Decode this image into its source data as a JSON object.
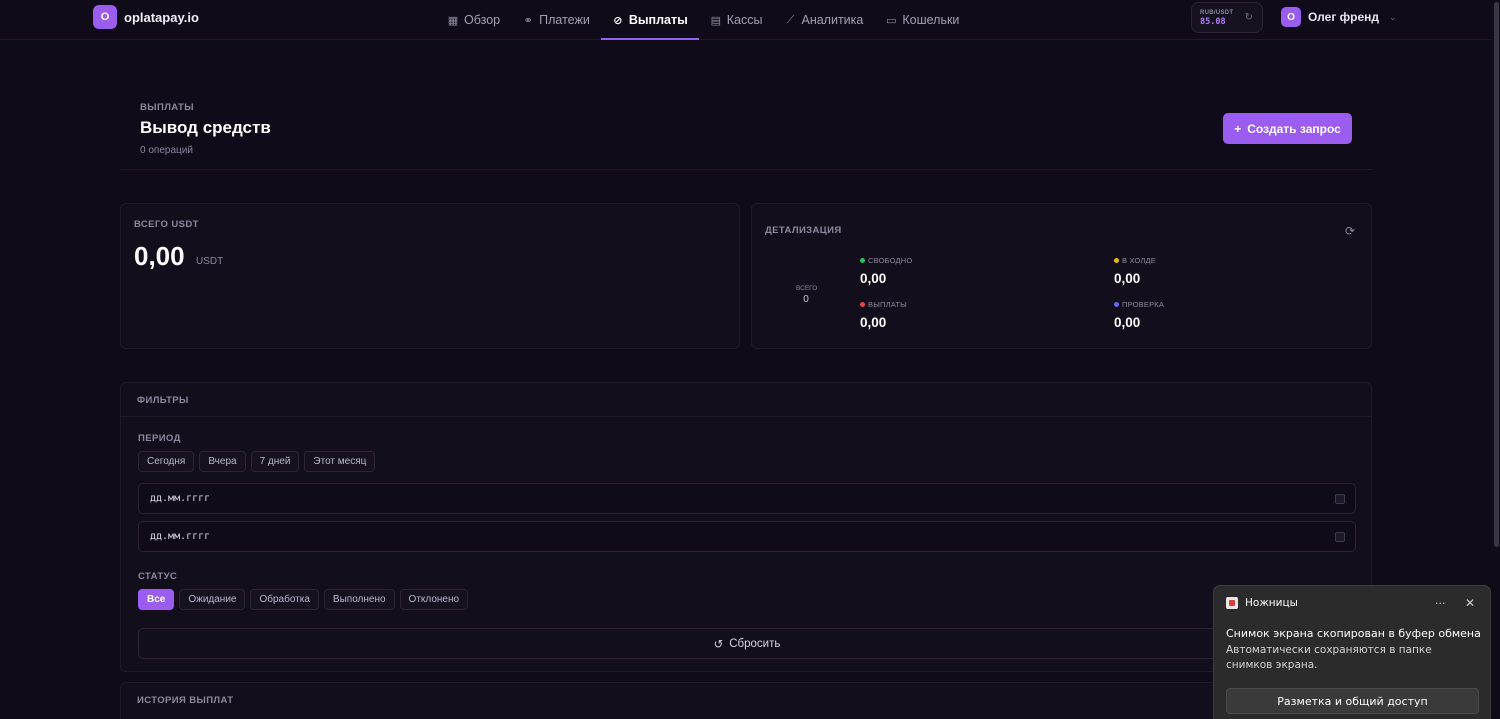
{
  "brand": {
    "logo_letter": "O",
    "name": "oplatapay.io"
  },
  "nav": [
    {
      "label": "Обзор",
      "icon": "layout-grid-icon",
      "glyph": "▦",
      "active": false
    },
    {
      "label": "Платежи",
      "icon": "link-icon",
      "glyph": "⚭",
      "active": false
    },
    {
      "label": "Выплаты",
      "icon": "compass-icon",
      "glyph": "⊘",
      "active": true
    },
    {
      "label": "Кассы",
      "icon": "store-icon",
      "glyph": "▤",
      "active": false
    },
    {
      "label": "Аналитика",
      "icon": "chart-line-icon",
      "glyph": "⟋",
      "active": false
    },
    {
      "label": "Кошельки",
      "icon": "wallet-icon",
      "glyph": "▭",
      "active": false
    }
  ],
  "rate": {
    "label": "RUB/USDT",
    "value": "85.08"
  },
  "user": {
    "avatar_letter": "O",
    "name": "Олег френд"
  },
  "page": {
    "eyebrow": "ВЫПЛАТЫ",
    "title": "Вывод средств",
    "subtitle": "0 операций",
    "create_button": "Создать запрос"
  },
  "total": {
    "label": "ВСЕГО USDT",
    "value": "0,00",
    "unit": "USDT"
  },
  "detail": {
    "label": "ДЕТАЛИЗАЦИЯ",
    "donut_label": "ВСЕГО",
    "donut_value": "0",
    "stats": [
      {
        "label": "СВОБОДНО",
        "value": "0,00",
        "color": "#22c55e"
      },
      {
        "label": "В ХОЛДЕ",
        "value": "0,00",
        "color": "#eab308"
      },
      {
        "label": "ВЫПЛАТЫ",
        "value": "0,00",
        "color": "#ef4444"
      },
      {
        "label": "ПРОВЕРКА",
        "value": "0,00",
        "color": "#6366f1"
      }
    ]
  },
  "filters": {
    "title": "ФИЛЬТРЫ",
    "period_label": "ПЕРИОД",
    "period_chips": [
      "Сегодня",
      "Вчера",
      "7 дней",
      "Этот месяц"
    ],
    "date_from_placeholder": "дд.мм.гггг",
    "date_to_placeholder": "дд.мм.гггг",
    "status_label": "СТАТУС",
    "status_chips": [
      "Все",
      "Ожидание",
      "Обработка",
      "Выполнено",
      "Отклонено"
    ],
    "reset_button": "Сбросить"
  },
  "history": {
    "title": "ИСТОРИЯ ВЫПЛАТ"
  },
  "toast": {
    "app_name": "Ножницы",
    "title": "Снимок экрана скопирован в буфер обмена",
    "body": "Автоматически сохраняются в папке снимков экрана.",
    "action": "Разметка и общий доступ"
  },
  "colors": {
    "accent": "#9b5cf0",
    "background": "#0f0b18",
    "card": "#120e1b"
  }
}
